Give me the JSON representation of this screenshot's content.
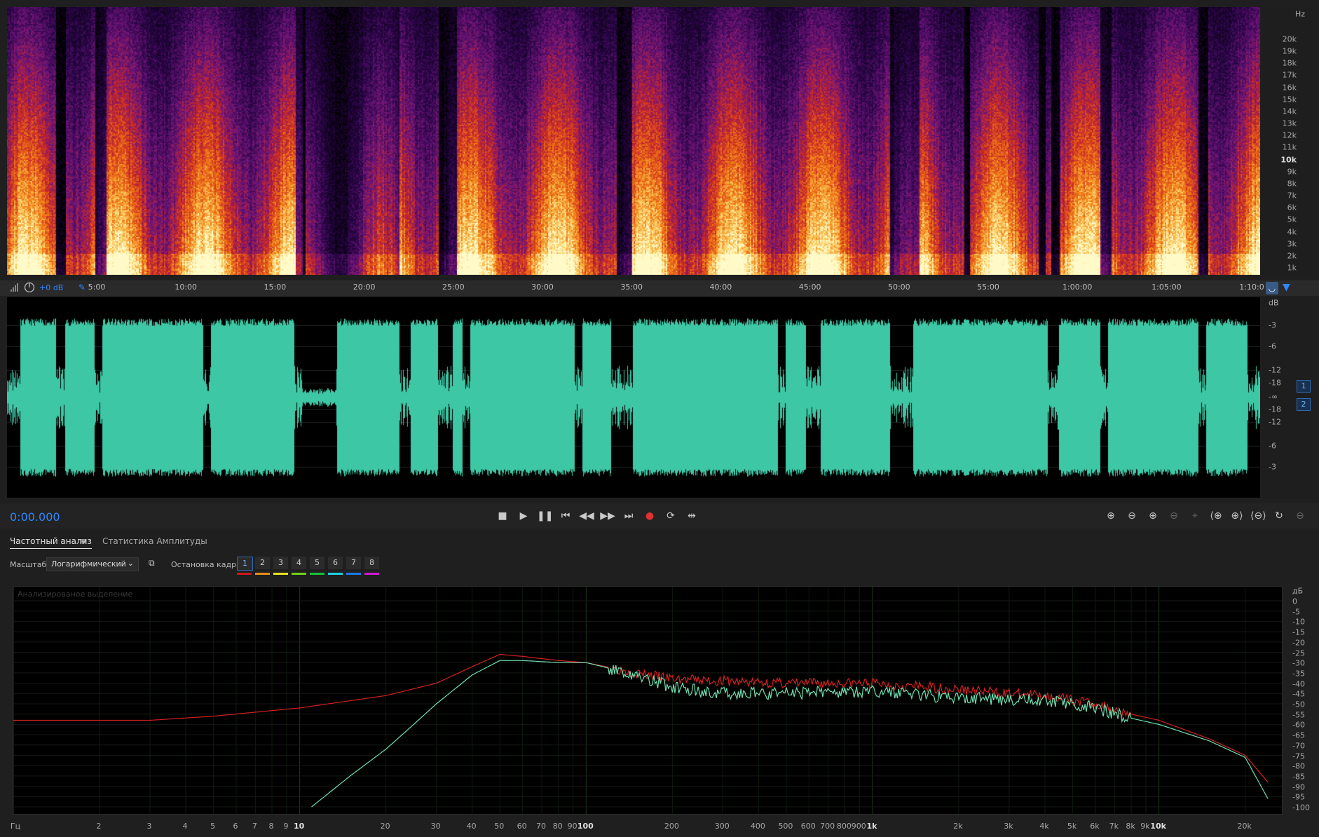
{
  "spectrogram": {
    "hz_unit": "Hz",
    "hz_labels": [
      "20k",
      "19k",
      "18k",
      "17k",
      "16k",
      "15k",
      "14k",
      "13k",
      "12k",
      "11k",
      "10k",
      "9k",
      "8k",
      "7k",
      "6k",
      "5k",
      "4k",
      "3k",
      "2k",
      "1k"
    ]
  },
  "ruler": {
    "gain": "+0 dB",
    "time_labels": [
      "5:00",
      "10:00",
      "15:00",
      "20:00",
      "25:00",
      "30:00",
      "35:00",
      "40:00",
      "45:00",
      "50:00",
      "55:00",
      "1:00:00",
      "1:05:00",
      "1:10:0"
    ]
  },
  "waveform": {
    "db_unit": "dB",
    "db_labels": [
      "-3",
      "-6",
      "-12",
      "-18",
      "-∞",
      "-18",
      "-12",
      "-6",
      "-3"
    ],
    "channels": [
      "1",
      "2"
    ],
    "color": "#3ec7a5"
  },
  "transport": {
    "timecode": "0:00.000"
  },
  "panel": {
    "tab_frequency": "Частотный анализ",
    "tab_amplitude": "Статистика Амплитуды",
    "scale_label": "Масштаб:",
    "scale_value": "Логарифмический",
    "freeze_label": "Остановка кадра:",
    "freeze_buttons": [
      "1",
      "2",
      "3",
      "4",
      "5",
      "6",
      "7",
      "8"
    ],
    "freeze_colors": [
      "#d01818",
      "#e88a1a",
      "#e8e21a",
      "#6fd01a",
      "#1ac03a",
      "#1ad0e0",
      "#1a7ae8",
      "#d01ad0"
    ],
    "graph_caption": "Анализированое выделение"
  },
  "chart_data": {
    "type": "line",
    "xscale": "log",
    "xlabel": "Гц",
    "ylabel": "дБ",
    "ylim": [
      -100,
      0
    ],
    "x_tick_labels": [
      "Гц",
      "2",
      "3",
      "4",
      "5",
      "6",
      "7",
      "8",
      "9",
      "10",
      "20",
      "30",
      "40",
      "50",
      "60",
      "70",
      "80",
      "90",
      "100",
      "200",
      "300",
      "400",
      "500",
      "600",
      "700",
      "800",
      "900",
      "1k",
      "2k",
      "3k",
      "4k",
      "5k",
      "6k",
      "7k",
      "8k",
      "9k",
      "10k",
      "20k"
    ],
    "y_tick_labels": [
      "дБ",
      "0",
      "-5",
      "-10",
      "-15",
      "-20",
      "-25",
      "-30",
      "-35",
      "-40",
      "-45",
      "-50",
      "-55",
      "-60",
      "-65",
      "-70",
      "-75",
      "-80",
      "-85",
      "-90",
      "-95",
      "-100"
    ],
    "series": [
      {
        "color": "#d42020",
        "x": [
          1,
          3,
          5,
          10,
          20,
          30,
          40,
          50,
          60,
          80,
          100,
          150,
          200,
          300,
          500,
          800,
          1000,
          2000,
          3000,
          4000,
          6000,
          8000,
          10000,
          15000,
          20000,
          24000
        ],
        "y": [
          -58,
          -58,
          -56,
          -52,
          -46,
          -40,
          -32,
          -26,
          -27,
          -29,
          -30,
          -35,
          -38,
          -39,
          -40,
          -40,
          -40,
          -43,
          -45,
          -46,
          -50,
          -55,
          -58,
          -67,
          -75,
          -88
        ]
      },
      {
        "color": "#6fe0b0",
        "x": [
          11,
          15,
          20,
          25,
          30,
          40,
          50,
          60,
          80,
          100,
          150,
          200,
          300,
          500,
          800,
          1000,
          2000,
          3000,
          4000,
          6000,
          8000,
          10000,
          15000,
          20000,
          24000
        ],
        "y": [
          -100,
          -85,
          -72,
          -60,
          -50,
          -36,
          -29,
          -29,
          -30,
          -30,
          -36,
          -42,
          -45,
          -45,
          -44,
          -44,
          -47,
          -48,
          -48,
          -52,
          -57,
          -60,
          -68,
          -76,
          -96
        ]
      }
    ]
  }
}
